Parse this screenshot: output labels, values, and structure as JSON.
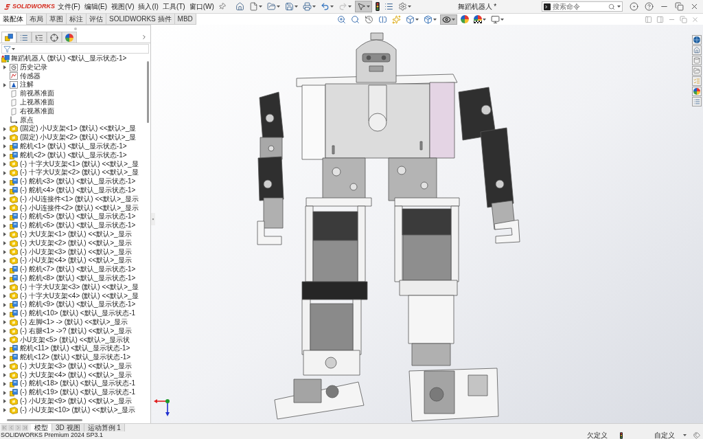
{
  "title_bar": {
    "logo": "SOLIDWORKS",
    "menus": [
      "文件(F)",
      "编辑(E)",
      "视图(V)",
      "插入(I)",
      "工具(T)",
      "窗口(W)"
    ],
    "quick_access": [
      {
        "kind": "home",
        "dropdown": false,
        "selected": false,
        "disabled": false
      },
      {
        "kind": "new",
        "dropdown": true,
        "selected": false,
        "disabled": false
      },
      {
        "kind": "open",
        "dropdown": true,
        "selected": false,
        "disabled": false
      },
      {
        "kind": "save",
        "dropdown": true,
        "selected": false,
        "disabled": false
      },
      {
        "kind": "print",
        "dropdown": true,
        "selected": false,
        "disabled": false
      },
      {
        "kind": "undo",
        "dropdown": true,
        "selected": false,
        "disabled": false
      },
      {
        "kind": "redo",
        "dropdown": true,
        "selected": false,
        "disabled": true
      },
      {
        "kind": "select",
        "dropdown": true,
        "selected": true,
        "disabled": false
      },
      {
        "kind": "rebuild",
        "dropdown": false,
        "selected": false,
        "disabled": false
      },
      {
        "kind": "file_properties",
        "dropdown": false,
        "selected": false,
        "disabled": false
      },
      {
        "kind": "options",
        "dropdown": true,
        "selected": false,
        "disabled": false
      }
    ],
    "document_title": "舞蹈机器人 *",
    "search": {
      "placeholder": "搜索命令"
    }
  },
  "command_tabs": [
    {
      "label": "装配体",
      "selected": true
    },
    {
      "label": "布局",
      "selected": false
    },
    {
      "label": "草图",
      "selected": false
    },
    {
      "label": "标注",
      "selected": false
    },
    {
      "label": "评估",
      "selected": false
    },
    {
      "label": "SOLIDWORKS 插件",
      "selected": false
    },
    {
      "label": "MBD",
      "selected": false
    }
  ],
  "view_toolbar": [
    {
      "kind": "zoom_fit",
      "dropdown": false,
      "selected": false
    },
    {
      "kind": "zoom_area",
      "dropdown": false,
      "selected": false
    },
    {
      "kind": "previous_view",
      "dropdown": false,
      "selected": false
    },
    {
      "kind": "section_view",
      "dropdown": false,
      "selected": false
    },
    {
      "kind": "dynamic_annotation",
      "dropdown": false,
      "selected": false
    },
    {
      "kind": "view_orientation",
      "dropdown": true,
      "selected": false
    },
    {
      "kind": "display_style",
      "dropdown": true,
      "selected": false
    },
    {
      "kind": "hide_show",
      "dropdown": true,
      "selected": true
    },
    {
      "kind": "edit_appearance",
      "dropdown": false,
      "selected": false
    },
    {
      "kind": "apply_scene",
      "dropdown": true,
      "selected": false
    },
    {
      "kind": "view_settings",
      "dropdown": true,
      "selected": false
    }
  ],
  "panel_tabs": [
    {
      "kind": "feature_manager",
      "selected": true
    },
    {
      "kind": "property_manager",
      "selected": false
    },
    {
      "kind": "configuration_manager",
      "selected": false
    },
    {
      "kind": "dimxpert",
      "selected": false
    },
    {
      "kind": "display_manager",
      "selected": false
    }
  ],
  "feature_tree": {
    "label": "舞蹈机器人 (默认) <默认_显示状态-1>",
    "kind": "assembly",
    "children": [
      {
        "label": "历史记录",
        "kind": "history",
        "expandable": true
      },
      {
        "label": "传感器",
        "kind": "sensors",
        "expandable": false
      },
      {
        "label": "注解",
        "kind": "annotations",
        "expandable": true
      },
      {
        "label": "前视基准面",
        "kind": "plane",
        "expandable": false
      },
      {
        "label": "上视基准面",
        "kind": "plane",
        "expandable": false
      },
      {
        "label": "右视基准面",
        "kind": "plane",
        "expandable": false
      },
      {
        "label": "原点",
        "kind": "origin",
        "expandable": false
      },
      {
        "label": "(固定) 小U支架<1> (默认) <<默认>_显",
        "kind": "part",
        "expandable": true
      },
      {
        "label": "(固定) 小U支架<2> (默认) <<默认>_显",
        "kind": "part",
        "expandable": true
      },
      {
        "label": "舵机<1> (默认) <默认_显示状态-1>",
        "kind": "subassembly",
        "expandable": true
      },
      {
        "label": "舵机<2> (默认) <默认_显示状态-1>",
        "kind": "subassembly",
        "expandable": true
      },
      {
        "label": "(-) 十字大U支架<1> (默认) <<默认>_显",
        "kind": "part",
        "expandable": true
      },
      {
        "label": "(-) 十字大U支架<2> (默认) <<默认>_显",
        "kind": "part",
        "expandable": true
      },
      {
        "label": "(-) 舵机<3> (默认) <默认_显示状态-1>",
        "kind": "subassembly",
        "expandable": true
      },
      {
        "label": "(-) 舵机<4> (默认) <默认_显示状态-1>",
        "kind": "subassembly",
        "expandable": true
      },
      {
        "label": "(-) 小U连接件<1> (默认) <<默认>_显示",
        "kind": "part",
        "expandable": true
      },
      {
        "label": "(-) 小U连接件<2> (默认) <<默认>_显示",
        "kind": "part",
        "expandable": true
      },
      {
        "label": "(-) 舵机<5> (默认) <默认_显示状态-1>",
        "kind": "subassembly",
        "expandable": true
      },
      {
        "label": "(-) 舵机<6> (默认) <默认_显示状态-1>",
        "kind": "subassembly",
        "expandable": true
      },
      {
        "label": "(-) 大U支架<1> (默认) <<默认>_显示",
        "kind": "part",
        "expandable": true
      },
      {
        "label": "(-) 大U支架<2> (默认) <<默认>_显示",
        "kind": "part",
        "expandable": true
      },
      {
        "label": "(-) 小U支架<3> (默认) <<默认>_显示",
        "kind": "part",
        "expandable": true
      },
      {
        "label": "(-) 小U支架<4> (默认) <<默认>_显示",
        "kind": "part",
        "expandable": true
      },
      {
        "label": "(-) 舵机<7> (默认) <默认_显示状态-1>",
        "kind": "subassembly",
        "expandable": true
      },
      {
        "label": "(-) 舵机<8> (默认) <默认_显示状态-1>",
        "kind": "subassembly",
        "expandable": true
      },
      {
        "label": "(-) 十字大U支架<3> (默认) <<默认>_显",
        "kind": "part",
        "expandable": true
      },
      {
        "label": "(-) 十字大U支架<4> (默认) <<默认>_显",
        "kind": "part",
        "expandable": true
      },
      {
        "label": "(-) 舵机<9> (默认) <默认_显示状态-1>",
        "kind": "subassembly",
        "expandable": true
      },
      {
        "label": "(-) 舵机<10> (默认) <默认_显示状态-1",
        "kind": "subassembly",
        "expandable": true
      },
      {
        "label": "(-) 左脚<1> -> (默认) <<默认>_显示",
        "kind": "part",
        "expandable": true
      },
      {
        "label": "(-) 右腿<1> ->? (默认) <<默认>_显示",
        "kind": "part",
        "expandable": true
      },
      {
        "label": "小U支架<5> (默认) <<默认>_显示状",
        "kind": "part",
        "expandable": true
      },
      {
        "label": "舵机<11> (默认) <默认_显示状态-1>",
        "kind": "subassembly",
        "expandable": true
      },
      {
        "label": "舵机<12> (默认) <默认_显示状态-1>",
        "kind": "subassembly",
        "expandable": true
      },
      {
        "label": "(-) 大U支架<3> (默认) <<默认>_显示",
        "kind": "part",
        "expandable": true
      },
      {
        "label": "(-) 大U支架<4> (默认) <<默认>_显示",
        "kind": "part",
        "expandable": true
      },
      {
        "label": "(-) 舵机<18> (默认) <默认_显示状态-1",
        "kind": "subassembly",
        "expandable": true
      },
      {
        "label": "(-) 舵机<19> (默认) <默认_显示状态-1",
        "kind": "subassembly",
        "expandable": true
      },
      {
        "label": "(-) 小U支架<9> (默认) <<默认>_显示",
        "kind": "part",
        "expandable": true
      },
      {
        "label": "(-) 小U支架<10> (默认) <<默认>_显示",
        "kind": "part",
        "expandable": true
      }
    ]
  },
  "bottom_tabs": [
    {
      "label": "模型",
      "selected": true
    },
    {
      "label": "3D 视图",
      "selected": false
    },
    {
      "label": "运动算例 1",
      "selected": false
    }
  ],
  "status_bar": {
    "product": "SOLIDWORKS Premium 2024 SP3.1",
    "definition": "欠定义",
    "units": "自定义"
  }
}
